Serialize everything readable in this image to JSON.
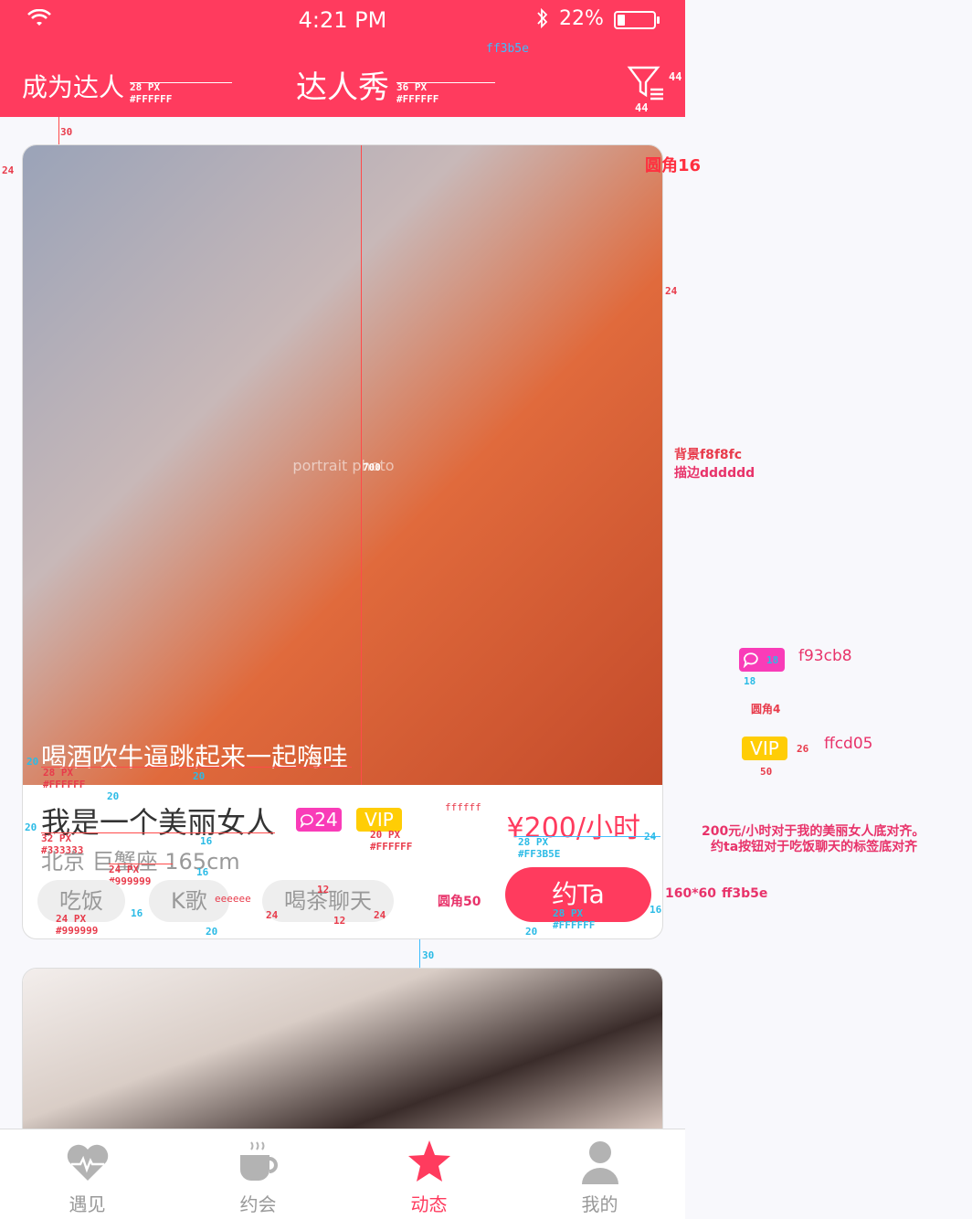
{
  "status_bar": {
    "time": "4:21 PM",
    "battery": "22%",
    "battery_level": 0.22
  },
  "header": {
    "left_link": "成为达人",
    "title": "达人秀",
    "left_spec": "28 PX\n#FFFFFF",
    "title_spec": "36 PX\n#FFFFFF",
    "bg_color_note": "ff3b5e",
    "icon_w_note": "44",
    "icon_h_note": "44"
  },
  "card": {
    "photo_caption": "喝酒吹牛逼跳起来一起嗨哇",
    "caption_spec": "28 PX\n#FFFFFF",
    "name": "我是一个美丽女人",
    "name_spec": "32 PX\n#333333",
    "comment_count": "24",
    "vip": "VIP",
    "badge_spec": "20 PX\n#FFFFFF",
    "badge_text_color_note": "ffffff",
    "price": "¥200/小时",
    "price_spec": "28 PX\n#FF3B5E",
    "location": "北京  巨蟹座  165cm",
    "location_spec": "24 PX\n#999999",
    "tags": [
      "吃饭",
      "K歌",
      "喝茶聊天"
    ],
    "tag_spec": "24 PX\n#999999",
    "tag_bg_note": "eeeeee",
    "tag_radius_note": "圆角50",
    "button_label": "约Ta",
    "button_spec": "28 PX\n#FFFFFF",
    "photo_height_note": "700",
    "photo_alt": "portrait photo"
  },
  "spacing": {
    "s30": "30",
    "s24": "24",
    "s20": "20",
    "s16": "16",
    "s12": "12",
    "s18": "18",
    "s26": "26",
    "s50": "50"
  },
  "annotations": {
    "radius16": "圆角16",
    "bg_title": "背景f8f8fc",
    "bg_stroke": "描边dddddd",
    "comment_color": "f93cb8",
    "radius4": "圆角4",
    "vip_color": "ffcd05",
    "align_note_1": "200元/小时对于我的美丽女人底对齐。",
    "align_note_2": "约ta按钮对于吃饭聊天的标签底对齐",
    "button_size": "160*60",
    "button_color": "ff3b5e"
  },
  "tabbar": {
    "items": [
      {
        "label": "遇见",
        "icon": "heart-pulse-icon"
      },
      {
        "label": "约会",
        "icon": "coffee-cup-icon"
      },
      {
        "label": "动态",
        "icon": "star-icon"
      },
      {
        "label": "我的",
        "icon": "user-icon"
      }
    ],
    "active_index": 2
  },
  "colors": {
    "brand": "#ff3b5e",
    "background": "#f8f8fc",
    "stroke": "#dddddd",
    "comment_badge": "#f93cb8",
    "vip_badge": "#ffcd05",
    "tag_bg": "#eeeeee"
  }
}
